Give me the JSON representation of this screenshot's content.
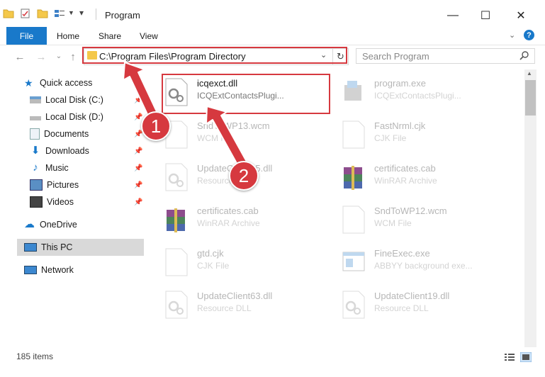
{
  "window": {
    "title": "Program",
    "minimize": "—",
    "maximize": "☐",
    "close": "✕"
  },
  "ribbon": {
    "tabs": [
      "File",
      "Home",
      "Share",
      "View"
    ],
    "help": "?"
  },
  "address": {
    "path": "C:\\Program Files\\Program Directory",
    "search_placeholder": "Search Program"
  },
  "nav": {
    "items": [
      {
        "label": "Quick access",
        "icon": "star-icon"
      },
      {
        "label": "Local Disk (C:)",
        "icon": "drive-icon",
        "pinned": true
      },
      {
        "label": "Local Disk (D:)",
        "icon": "drive-icon",
        "pinned": true
      },
      {
        "label": "Documents",
        "icon": "documents-icon",
        "pinned": true
      },
      {
        "label": "Downloads",
        "icon": "download-icon",
        "pinned": true
      },
      {
        "label": "Music",
        "icon": "music-icon",
        "pinned": true
      },
      {
        "label": "Pictures",
        "icon": "pictures-icon",
        "pinned": true
      },
      {
        "label": "Videos",
        "icon": "videos-icon",
        "pinned": true
      },
      {
        "label": "OneDrive",
        "icon": "cloud-icon"
      },
      {
        "label": "This PC",
        "icon": "computer-icon",
        "selected": true
      },
      {
        "label": "Network",
        "icon": "network-icon"
      }
    ]
  },
  "files": [
    {
      "name": "icqexct.dll",
      "type": "ICQExtContactsPlugi...",
      "icon": "dll-gear-icon",
      "highlighted": true
    },
    {
      "name": "program.exe",
      "type": "ICQExtContactsPlugi...",
      "icon": "exe-icon"
    },
    {
      "name": "SndToWP13.wcm",
      "type": "WCM File",
      "icon": "file-icon"
    },
    {
      "name": "FastNrml.cjk",
      "type": "CJK File",
      "icon": "file-icon"
    },
    {
      "name": "UpdateClient65.dll",
      "type": "Resource DLL",
      "icon": "dll-gear-icon"
    },
    {
      "name": "certificates.cab",
      "type": "WinRAR Archive",
      "icon": "archive-icon"
    },
    {
      "name": "certificates.cab",
      "type": "WinRAR Archive",
      "icon": "archive-icon"
    },
    {
      "name": "SndToWP12.wcm",
      "type": "WCM File",
      "icon": "file-icon"
    },
    {
      "name": "gtd.cjk",
      "type": "CJK File",
      "icon": "file-icon"
    },
    {
      "name": "FineExec.exe",
      "type": "ABBYY background exe...",
      "icon": "app-window-icon"
    },
    {
      "name": "UpdateClient63.dll",
      "type": "Resource DLL",
      "icon": "dll-gear-icon"
    },
    {
      "name": "UpdateClient19.dll",
      "type": "Resource DLL",
      "icon": "dll-gear-icon"
    }
  ],
  "status": {
    "items": "185 items"
  },
  "annotations": [
    {
      "label": "1"
    },
    {
      "label": "2"
    }
  ],
  "colors": {
    "accent": "#1979ca",
    "highlight": "#d6393f"
  }
}
